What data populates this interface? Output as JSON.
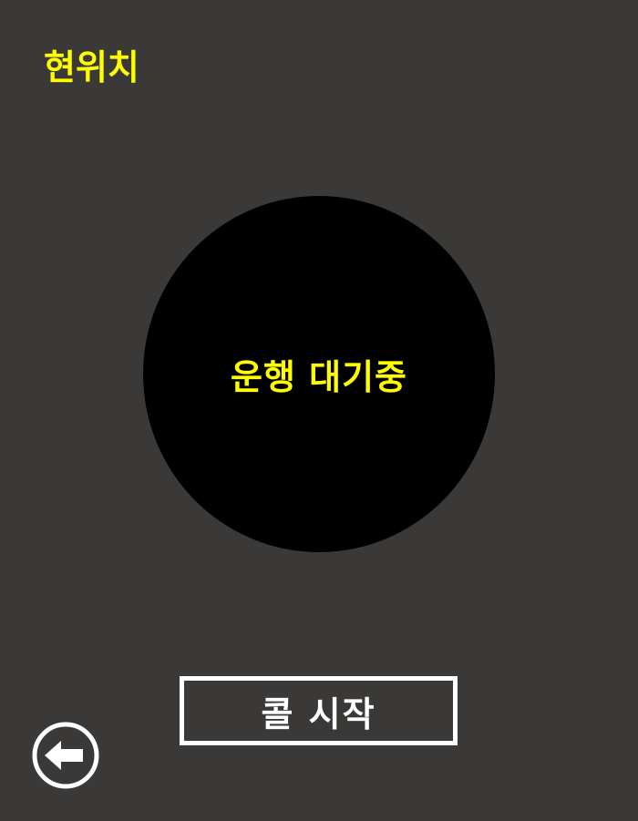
{
  "header": {
    "location_label": "현위치"
  },
  "status": {
    "text": "운행 대기중"
  },
  "actions": {
    "call_start_label": "콜 시작"
  },
  "navigation": {
    "back_icon": "back-arrow-icon"
  },
  "colors": {
    "background": "#3a3938",
    "accent_text": "#ffff00",
    "circle": "#000000",
    "button_border": "#ffffff"
  }
}
